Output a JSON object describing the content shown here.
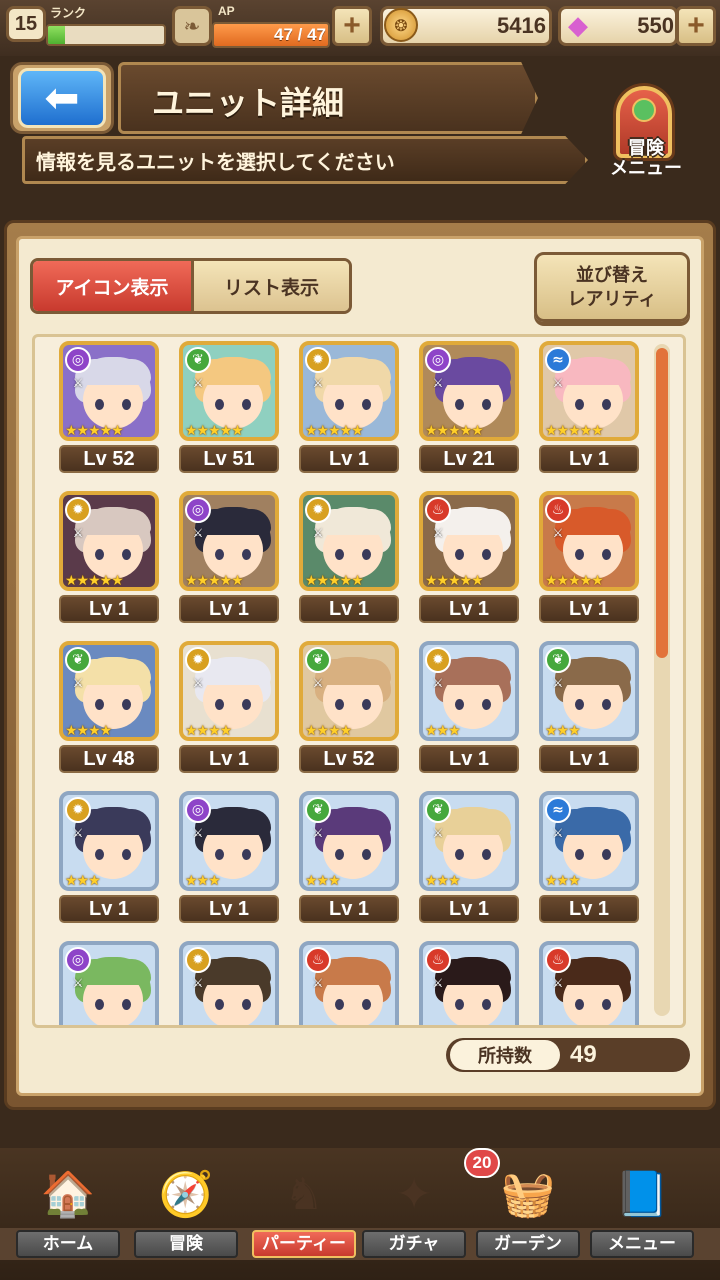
{
  "status": {
    "rank_label": "ランク",
    "rank": "15",
    "rank_progress": 0.15,
    "ap_label": "AP",
    "ap": "47 / 47",
    "ap_progress": 1.0,
    "coins": "5416",
    "gems": "550",
    "plus_symbol": "+"
  },
  "header": {
    "title": "ユニット詳細",
    "subtitle": "情報を見るユニットを選択してください",
    "adventure_menu_line1": "冒険",
    "adventure_menu_line2": "メニュー"
  },
  "view_tabs": {
    "icon_view": "アイコン表示",
    "list_view": "リスト表示"
  },
  "sort": {
    "line1": "並び替え",
    "line2": "レアリティ"
  },
  "elements": {
    "dark": {
      "color": "#8e44c8",
      "glyph": "◎"
    },
    "wind": {
      "color": "#46a83c",
      "glyph": "❦"
    },
    "light": {
      "color": "#d8a020",
      "glyph": "✹"
    },
    "water": {
      "color": "#2c7ad8",
      "glyph": "≈"
    },
    "fire": {
      "color": "#d83a2a",
      "glyph": "♨"
    }
  },
  "units": [
    {
      "level": "Lv 52",
      "element": "dark",
      "stars": 5,
      "hair": "#d8d8e8",
      "bg": "#8a70c8",
      "frame": "gold"
    },
    {
      "level": "Lv 51",
      "element": "wind",
      "stars": 5,
      "hair": "#f4c880",
      "bg": "#8fd0c0",
      "frame": "gold"
    },
    {
      "level": "Lv 1",
      "element": "light",
      "stars": 5,
      "hair": "#f0d8a8",
      "bg": "#9ab8d8",
      "frame": "gold"
    },
    {
      "level": "Lv 21",
      "element": "dark",
      "stars": 5,
      "hair": "#6a4aa0",
      "bg": "#b08a5a",
      "frame": "gold"
    },
    {
      "level": "Lv 1",
      "element": "water",
      "stars": 5,
      "hair": "#f8b8c0",
      "bg": "#e0c8a8",
      "frame": "gold"
    },
    {
      "level": "Lv 1",
      "element": "light",
      "stars": 5,
      "hair": "#d8c8c0",
      "bg": "#5a3a4a",
      "frame": "gold"
    },
    {
      "level": "Lv 1",
      "element": "dark",
      "stars": 5,
      "hair": "#2a2a3a",
      "bg": "#a08060",
      "frame": "gold"
    },
    {
      "level": "Lv 1",
      "element": "light",
      "stars": 5,
      "hair": "#f0e8d8",
      "bg": "#5a8a6a",
      "frame": "gold"
    },
    {
      "level": "Lv 1",
      "element": "fire",
      "stars": 5,
      "hair": "#f4f0ec",
      "bg": "#8a6a4a",
      "frame": "gold"
    },
    {
      "level": "Lv 1",
      "element": "fire",
      "stars": 5,
      "hair": "#d85a2a",
      "bg": "#c87a4a",
      "frame": "gold"
    },
    {
      "level": "Lv 48",
      "element": "wind",
      "stars": 4,
      "hair": "#f4e0a8",
      "bg": "#6a8ac0",
      "frame": "gold"
    },
    {
      "level": "Lv 1",
      "element": "light",
      "stars": 4,
      "hair": "#e8e8f0",
      "bg": "#e8e0d0",
      "frame": "gold"
    },
    {
      "level": "Lv 52",
      "element": "wind",
      "stars": 4,
      "hair": "#d8b080",
      "bg": "#e0c8a0",
      "frame": "gold"
    },
    {
      "level": "Lv 1",
      "element": "light",
      "stars": 3,
      "hair": "#a8705a",
      "bg": "#c8dcf0",
      "frame": "silver"
    },
    {
      "level": "Lv 1",
      "element": "wind",
      "stars": 3,
      "hair": "#8a6a4a",
      "bg": "#c8dcf0",
      "frame": "silver"
    },
    {
      "level": "Lv 1",
      "element": "light",
      "stars": 3,
      "hair": "#3a3a5a",
      "bg": "#c8dcf0",
      "frame": "silver"
    },
    {
      "level": "Lv 1",
      "element": "dark",
      "stars": 3,
      "hair": "#2a2a3a",
      "bg": "#c8dcf0",
      "frame": "silver"
    },
    {
      "level": "Lv 1",
      "element": "wind",
      "stars": 3,
      "hair": "#5a3a7a",
      "bg": "#c8dcf0",
      "frame": "silver"
    },
    {
      "level": "Lv 1",
      "element": "wind",
      "stars": 3,
      "hair": "#e8d098",
      "bg": "#c8dcf0",
      "frame": "silver"
    },
    {
      "level": "Lv 1",
      "element": "water",
      "stars": 3,
      "hair": "#3a6aa8",
      "bg": "#c8dcf0",
      "frame": "silver"
    },
    {
      "level": "",
      "element": "dark",
      "stars": 0,
      "hair": "#7ab860",
      "bg": "#c8dcf0",
      "frame": "silver"
    },
    {
      "level": "",
      "element": "light",
      "stars": 0,
      "hair": "#4a3a2a",
      "bg": "#c8dcf0",
      "frame": "silver"
    },
    {
      "level": "",
      "element": "fire",
      "stars": 0,
      "hair": "#c87a4a",
      "bg": "#c8dcf0",
      "frame": "silver"
    },
    {
      "level": "",
      "element": "fire",
      "stars": 0,
      "hair": "#2a1a1a",
      "bg": "#c8dcf0",
      "frame": "silver"
    },
    {
      "level": "",
      "element": "fire",
      "stars": 0,
      "hair": "#4a2a1a",
      "bg": "#c8dcf0",
      "frame": "silver"
    }
  ],
  "owned": {
    "label": "所持数",
    "count": "49"
  },
  "nav": {
    "items": [
      {
        "label": "ホーム",
        "icon": "house-icon",
        "glyph": "🏠",
        "active": false
      },
      {
        "label": "冒険",
        "icon": "compass-icon",
        "glyph": "🧭",
        "active": false
      },
      {
        "label": "パーティー",
        "icon": "chess-icon",
        "glyph": "♞",
        "active": true
      },
      {
        "label": "ガチャ",
        "icon": "gacha-icon",
        "glyph": "✦",
        "active": false
      },
      {
        "label": "ガーデン",
        "icon": "garden-icon",
        "glyph": "🧺",
        "active": false
      },
      {
        "label": "メニュー",
        "icon": "book-icon",
        "glyph": "📘",
        "active": false
      }
    ],
    "garden_badge": "20"
  },
  "colors": {
    "accent_red": "#d84a3a",
    "scroll_orange": "#e2733a",
    "panel_cream": "#f4ead0",
    "wood_brown": "#7b5a36"
  }
}
